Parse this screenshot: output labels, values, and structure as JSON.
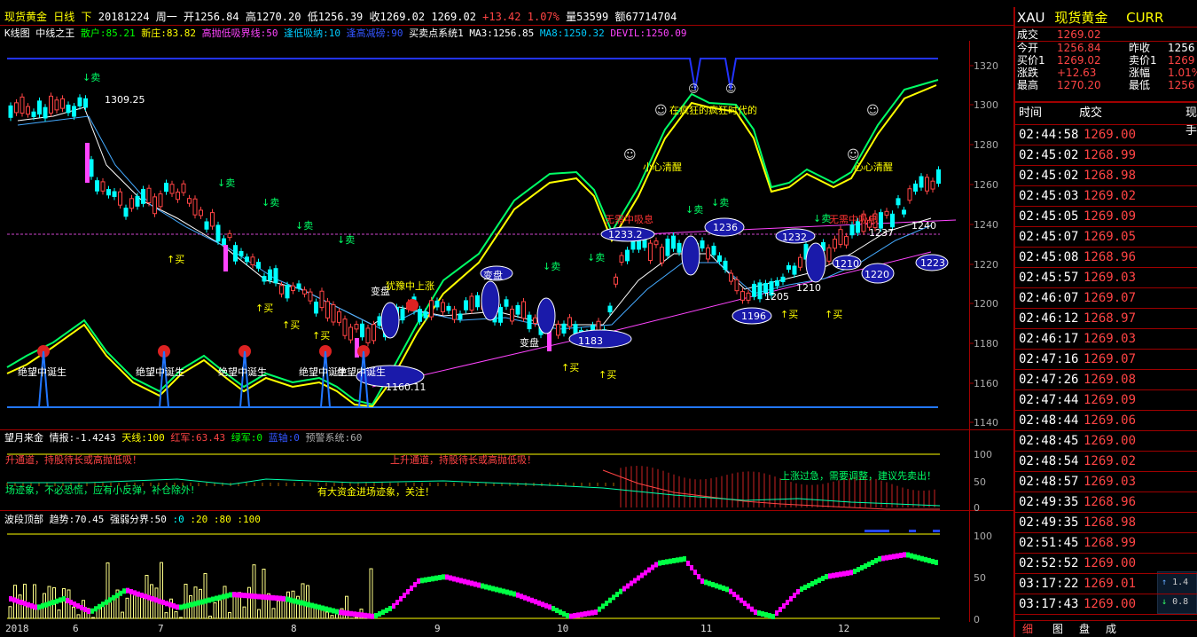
{
  "header": {
    "name": "现货黄金",
    "period": "日线",
    "nav": "下",
    "date": "20181224",
    "weekday": "周一",
    "open_label": "开",
    "open": "1256.84",
    "high_label": "高",
    "high": "1270.20",
    "low_label": "低",
    "low": "1256.39",
    "close_label": "收",
    "close": "1269.02",
    "last": "1269.02",
    "change": "+13.42",
    "pct": "1.07%",
    "vol_label": "量",
    "vol": "53599",
    "amt_label": "额",
    "amt": "67714704"
  },
  "indicator_bar": {
    "kline": "K线图",
    "plan": "中线之王",
    "sanhu": "散户:85.21",
    "xinzhuang": "新庄:83.82",
    "boundary": "高抛低吸界线:50",
    "dixi": "逢低吸纳:10",
    "gaopao": "逢高减磅:90",
    "bsp": "买卖点系统1",
    "ma3": "MA3:1256.85",
    "ma8": "MA8:1250.32",
    "devil": "DEVIL:1250.09"
  },
  "price_axis": [
    "1320",
    "1300",
    "1280",
    "1260",
    "1240",
    "1220",
    "1200",
    "1180",
    "1160",
    "1140"
  ],
  "chart_labels": {
    "sell": "↓卖",
    "buy": "↑买",
    "hi": "1309.25",
    "lo": "1160.11",
    "v1233": "1233.2",
    "v1236": "1236",
    "v1232": "1232",
    "v1183": "1183",
    "v1196": "1196",
    "v1205": "1205",
    "v1210": "1210",
    "v1210b": "1210",
    "v1220": "1220",
    "v1223": "1223",
    "v1237": "1237",
    "v1240": "1240",
    "despair": "绝望中诞生",
    "change": "变盘",
    "hesitate": "犹豫中上涨",
    "warn": "小心清醒",
    "wuxi": "无需中吸息",
    "wuxi2": "无需中吸息",
    "crazy": "在疯狂的疯狂时代的",
    "smile": "☺",
    "heart": "心心清醒"
  },
  "panel2": {
    "title": "望月来金",
    "info": "情报:-1.4243",
    "tianxian": "天线:100",
    "red": "红军:63.43",
    "green": "绿军:0",
    "blue": "蓝轴:0",
    "warn": "预警系统:60",
    "msg1": "升通道，持股待长或高抛低吸！",
    "msg2": "上升通道，持股待长或高抛低吸！",
    "msg3": "场迹象，不必恐慌，应有小反弹，补仓除外!",
    "msg4": "有大资金进场迹象，关注！",
    "msg5": "上涨过急，需要调整，建议先卖出！",
    "axis": [
      "100",
      "50",
      "0"
    ]
  },
  "panel3": {
    "title": "波段顶部",
    "trend": "趋势:70.45",
    "boundary": "强弱分界:50",
    "lv": [
      ":0",
      ":20",
      ":80",
      ":100"
    ],
    "axis": [
      "100",
      "50",
      "0"
    ]
  },
  "dates": [
    "2018",
    "6",
    "7",
    "8",
    "9",
    "10",
    "11",
    "12"
  ],
  "side": {
    "code": "XAU",
    "name": "现货黄金",
    "tag": "CURR",
    "deal_label": "成交",
    "deal": "1269.02",
    "open_label": "今开",
    "open": "1256.84",
    "prev_label": "昨收",
    "prev": "1256",
    "buy_label": "买价1",
    "buy": "1269.02",
    "sell_label": "卖价1",
    "sell": "1269",
    "chg_label": "涨跌",
    "chg": "+12.63",
    "amp_label": "涨幅",
    "amp": "1.01%",
    "high_label": "最高",
    "high": "1270.20",
    "low_label": "最低",
    "low": "1256",
    "ticks_head": [
      "时间",
      "成交",
      "现手"
    ],
    "ticks": [
      {
        "t": "02:44:58",
        "p": "1269.00"
      },
      {
        "t": "02:45:02",
        "p": "1268.99"
      },
      {
        "t": "02:45:02",
        "p": "1268.98"
      },
      {
        "t": "02:45:03",
        "p": "1269.02"
      },
      {
        "t": "02:45:05",
        "p": "1269.09"
      },
      {
        "t": "02:45:07",
        "p": "1269.05"
      },
      {
        "t": "02:45:08",
        "p": "1268.96"
      },
      {
        "t": "02:45:57",
        "p": "1269.03"
      },
      {
        "t": "02:46:07",
        "p": "1269.07"
      },
      {
        "t": "02:46:12",
        "p": "1268.97"
      },
      {
        "t": "02:46:17",
        "p": "1269.03"
      },
      {
        "t": "02:47:16",
        "p": "1269.07"
      },
      {
        "t": "02:47:26",
        "p": "1269.08"
      },
      {
        "t": "02:47:44",
        "p": "1269.09"
      },
      {
        "t": "02:48:44",
        "p": "1269.06"
      },
      {
        "t": "02:48:45",
        "p": "1269.00"
      },
      {
        "t": "02:48:54",
        "p": "1269.02"
      },
      {
        "t": "02:48:57",
        "p": "1269.03"
      },
      {
        "t": "02:49:35",
        "p": "1268.96"
      },
      {
        "t": "02:49:35",
        "p": "1268.98"
      },
      {
        "t": "02:51:45",
        "p": "1268.99"
      },
      {
        "t": "02:52:52",
        "p": "1269.00"
      },
      {
        "t": "03:17:22",
        "p": "1269.01"
      },
      {
        "t": "03:17:43",
        "p": "1269.00"
      }
    ],
    "mini1": "1.4",
    "mini2": "0.8",
    "tabs": [
      "细",
      "图",
      "盘",
      "成"
    ]
  }
}
